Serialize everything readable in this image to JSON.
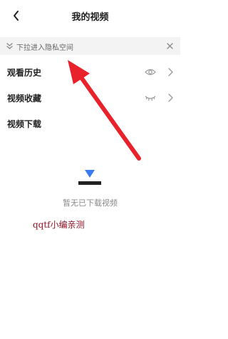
{
  "header": {
    "title": "我的视频"
  },
  "tip": {
    "text": "下拉进入隐私空间"
  },
  "menu": [
    {
      "label": "观看历史",
      "icon": "eye-icon"
    },
    {
      "label": "视频收藏",
      "icon": "closed-eye-icon"
    },
    {
      "label": "视频下载",
      "icon": ""
    }
  ],
  "empty": {
    "text": "暂无已下载视频",
    "icon": "download-icon"
  },
  "watermark": {
    "text": "qqtf小编亲测"
  },
  "colors": {
    "accent_blue": "#3b7cf0",
    "annotation_red": "#e8212a",
    "watermark_red": "#8a0f1f"
  }
}
